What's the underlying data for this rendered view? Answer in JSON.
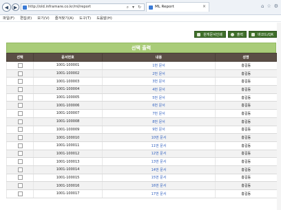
{
  "browser": {
    "url": "http://old.inframare.co.kr/ml/report",
    "tab_title": "ML Report",
    "back_icon": "back-arrow-icon",
    "forward_icon": "forward-arrow-icon"
  },
  "menu": [
    "파일(F)",
    "편집(E)",
    "보기(V)",
    "즐겨찾기(A)",
    "도구(T)",
    "도움말(H)"
  ],
  "toolbar": {
    "btn1": "원게문서인쇄",
    "btn2": "출력",
    "btn3": "바코드/QR"
  },
  "panel": {
    "title": "선택 출력"
  },
  "table": {
    "headers": [
      "선택",
      "문서번호",
      "내용",
      "성명"
    ],
    "rows": [
      {
        "doc": "1001-100001",
        "content": "1번 문서",
        "name": "홍길동"
      },
      {
        "doc": "1001-100002",
        "content": "2번 문서",
        "name": "홍길동"
      },
      {
        "doc": "1001-100003",
        "content": "3번 문서",
        "name": "홍길동"
      },
      {
        "doc": "1001-100004",
        "content": "4번 문서",
        "name": "홍길동"
      },
      {
        "doc": "1001-100005",
        "content": "5번 문서",
        "name": "홍길동"
      },
      {
        "doc": "1001-100006",
        "content": "6번 문서",
        "name": "홍길동"
      },
      {
        "doc": "1001-100007",
        "content": "7번 문서",
        "name": "홍길동"
      },
      {
        "doc": "1001-100008",
        "content": "8번 문서",
        "name": "홍길동"
      },
      {
        "doc": "1001-100009",
        "content": "9번 문서",
        "name": "홍길동"
      },
      {
        "doc": "1001-100010",
        "content": "10번 문서",
        "name": "홍길동"
      },
      {
        "doc": "1001-100011",
        "content": "11번 문서",
        "name": "홍길동"
      },
      {
        "doc": "1001-100012",
        "content": "12번 문서",
        "name": "홍길동"
      },
      {
        "doc": "1001-100013",
        "content": "13번 문서",
        "name": "홍길동"
      },
      {
        "doc": "1001-100014",
        "content": "14번 문서",
        "name": "홍길동"
      },
      {
        "doc": "1001-100015",
        "content": "15번 문서",
        "name": "홍길동"
      },
      {
        "doc": "1001-100016",
        "content": "16번 문서",
        "name": "홍길동"
      },
      {
        "doc": "1001-100017",
        "content": "17번 문서",
        "name": "홍길동"
      }
    ]
  },
  "colors": {
    "header_green": "#a9cc78",
    "th_brown": "#5a4e45",
    "button_green": "#3f6f2a",
    "link_blue": "#2f5fbf"
  }
}
